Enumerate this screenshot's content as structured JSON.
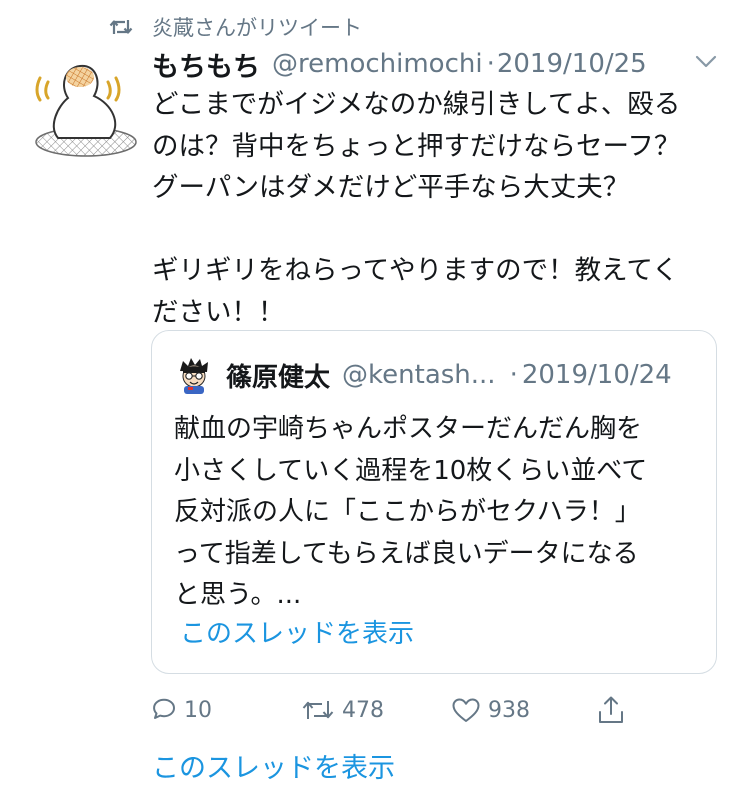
{
  "retweet": {
    "icon": "retweet-icon",
    "text": "炎蔵さんがリツイート"
  },
  "tweet": {
    "avatar_icon": "mochi-avatar",
    "name": "もちもち",
    "handle": "@remochimochi",
    "separator": "·",
    "date": "2019/10/25",
    "menu_icon": "chevron-down-icon",
    "text": "どこまでがイジメなのか線引きしてよ、殴る\nのは？背中をちょっと押すだけならセーフ？\nグーパンはダメだけど平手なら大丈夫？\n\nギリギリをねらってやりますので！教えてく\nださい！！"
  },
  "quote": {
    "avatar_icon": "cartoon-boy-avatar",
    "name": "篠原健太",
    "handle": "@kentash...",
    "separator": "·",
    "date": "2019/10/24",
    "text": "献血の宇崎ちゃんポスターだんだん胸を\n小さくしていく過程を10枚くらい並べて\n反対派の人に「ここからがセクハラ！」\nって指差してもらえば良いデータになる\nと思う。...",
    "thread_link": "このスレッドを表示"
  },
  "actions": {
    "reply": {
      "icon": "reply-icon",
      "count": "10"
    },
    "retweet": {
      "icon": "retweet-icon",
      "count": "478"
    },
    "like": {
      "icon": "heart-icon",
      "count": "938"
    },
    "share": {
      "icon": "share-icon"
    }
  },
  "thread_link": "このスレッドを表示",
  "colors": {
    "text": "#14171a",
    "secondary": "#657786",
    "link": "#1b95e0",
    "border": "#d5dde3"
  }
}
